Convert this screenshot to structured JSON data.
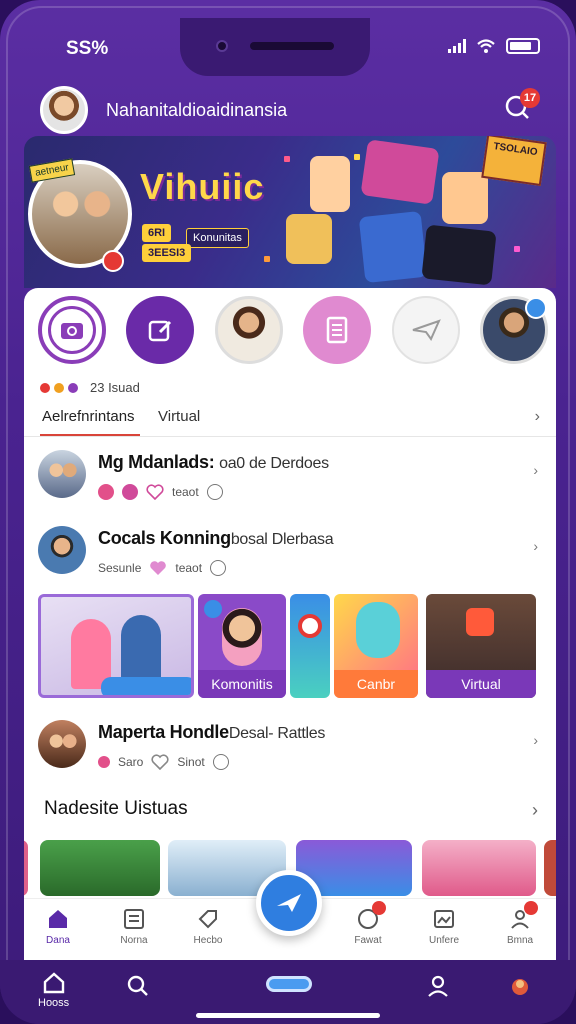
{
  "status": {
    "time": "SS%"
  },
  "header": {
    "title": "Nahanitaldioaidinansia",
    "notification_count": "17"
  },
  "banner": {
    "brand": "Vihuiic",
    "tag": "6RI",
    "tag2": "Konunitas",
    "tag3": "3EESI3",
    "sign_left": "aetneur",
    "sign_right": "TSOLAIO"
  },
  "stories": [
    {
      "name": "camera"
    },
    {
      "name": "edit"
    },
    {
      "name": "user-woman"
    },
    {
      "name": "document"
    },
    {
      "name": "send"
    },
    {
      "name": "user-man"
    }
  ],
  "activity": {
    "count": "23 Isuad"
  },
  "tabs": {
    "active": "Aelrefnrintans",
    "second": "Virtual"
  },
  "feed": [
    {
      "name": "Mg Mdanlads:",
      "subtitle": "oa0 de Derdoes",
      "meta_label": "teaot"
    },
    {
      "name": "Cocals Konning",
      "subtitle": "bosal Dlerbasa",
      "meta_label_left": "Sesunle",
      "meta_label": "teaot"
    },
    {
      "name": "Maperta Hondle",
      "subtitle": "Desal- Rattles",
      "meta_label_left": "Saro",
      "meta_label": "Sinot"
    }
  ],
  "media": [
    {
      "label": ""
    },
    {
      "label": "Komonitis"
    },
    {
      "label": ""
    },
    {
      "label": "Canbr"
    },
    {
      "label": "Virtual"
    }
  ],
  "section": {
    "title": "Nadesite Uistuas"
  },
  "inner_nav": [
    {
      "label": "Dana"
    },
    {
      "label": "Norna"
    },
    {
      "label": "Hecbo"
    },
    {
      "label": "Fawat"
    },
    {
      "label": "Unfere"
    },
    {
      "label": "Bmna"
    }
  ],
  "bottom_nav": {
    "home": "Hooss"
  },
  "colors": {
    "accent": "#5a2aa8",
    "fab": "#2f7ee0",
    "badge": "#e53935",
    "pink": "#e2508a"
  }
}
